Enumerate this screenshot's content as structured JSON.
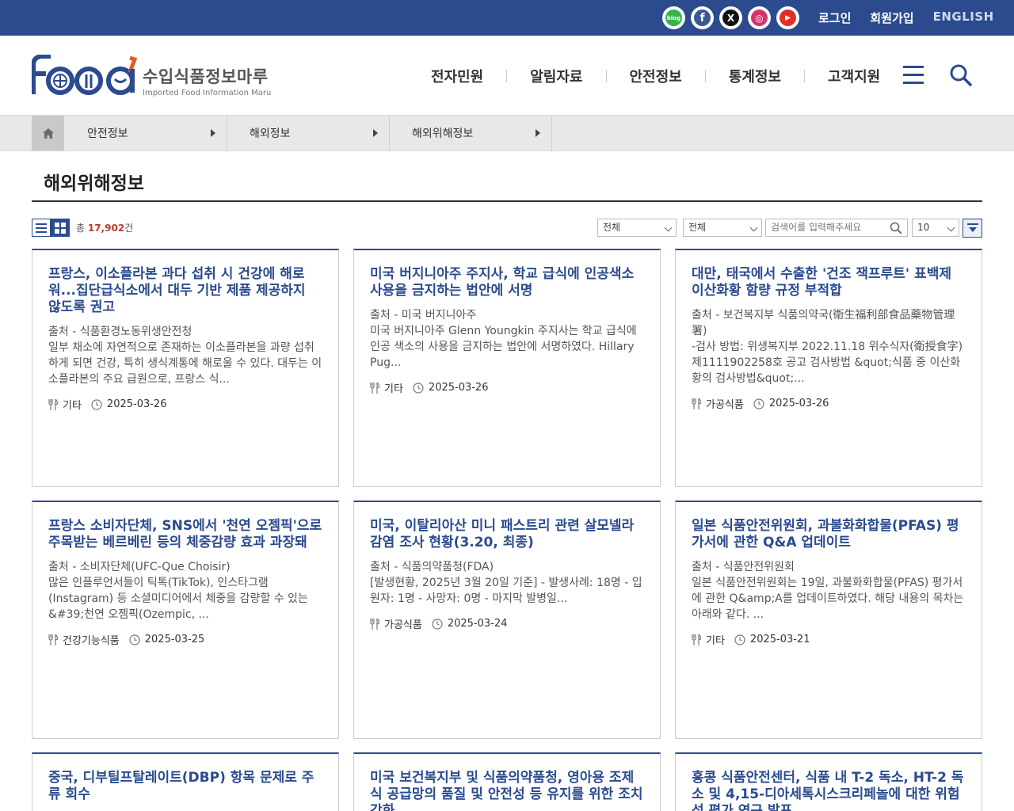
{
  "topbar": {
    "social_icons": [
      {
        "name": "blog-icon",
        "label": "blog",
        "color": "#35b34a"
      },
      {
        "name": "facebook-icon",
        "label": "f",
        "color": "#3b5998"
      },
      {
        "name": "x-icon",
        "label": "X",
        "color": "#111111"
      },
      {
        "name": "instagram-icon",
        "label": "◎",
        "color": "#d6336c"
      },
      {
        "name": "youtube-icon",
        "label": "▶",
        "color": "#e52d27"
      }
    ],
    "login": "로그인",
    "signup": "회원가입",
    "english": "ENGLISH"
  },
  "header": {
    "logo_kr": "수입식품정보마루",
    "logo_en": "Imported Food Information Maru",
    "menu": [
      "전자민원",
      "알림자료",
      "안전정보",
      "통계정보",
      "고객지원"
    ]
  },
  "breadcrumb": [
    "안전정보",
    "해외정보",
    "해외위해정보"
  ],
  "page_title": "해외위해정보",
  "toolbar": {
    "count_prefix": "총 ",
    "count_value": "17,902",
    "count_suffix": "건",
    "filter1": "전체",
    "filter2": "전체",
    "search_placeholder": "검색어를 입력해주세요",
    "page_size": "10"
  },
  "colors": {
    "brand": "#2b4b8e",
    "highlight": "#c0392b"
  },
  "cards": [
    {
      "title": "프랑스, 이소플라본 과다 섭취 시 건강에 해로워...집단급식소에서 대두 기반 제품 제공하지 않도록 권고",
      "source": "출처 - 식품환경노동위생안전청",
      "desc": "일부 채소에 자연적으로 존재하는 이소플라본을 과량 섭취하게 되면 건강, 특히 생식계통에 해로울 수 있다. 대두는 이소플라본의 주요 급원으로, 프랑스 식...",
      "category": "기타",
      "date": "2025-03-26"
    },
    {
      "title": "미국 버지니아주 주지사, 학교 급식에 인공색소 사용을 금지하는 법안에 서명",
      "source": "출처 - 미국 버지니아주",
      "desc": "미국 버지니아주 Glenn Youngkin 주지사는 학교 급식에 인공 색소의 사용을 금지하는 법안에 서명하였다. Hillary Pug...",
      "category": "기타",
      "date": "2025-03-26"
    },
    {
      "title": "대만, 태국에서 수출한 '건조 잭프루트' 표백제 이산화황 함량 규정 부적합",
      "source": "출처 - 보건복지부 식품의약국(衛生福利部食品藥物管理署)",
      "desc": "-검사 방법: 위생복지부 2022.11.18 위수식자(衛授食字) 제1111902258호 공고 검사방법 &quot;식품 중 이산화황의 검사방법&quot;...",
      "category": "가공식품",
      "date": "2025-03-26"
    },
    {
      "title": "프랑스 소비자단체, SNS에서 '천연 오젬픽'으로 주목받는 베르베린 등의 체중감량 효과 과장돼",
      "source": "출처 - 소비자단체(UFC-Que Choisir)",
      "desc": "많은 인플루언서들이 틱톡(TikTok), 인스타그램(Instagram) 등 소셜미디어에서 체중을 감량할 수 있는 &#39;천연 오젬픽(Ozempic, ...",
      "category": "건강기능식품",
      "date": "2025-03-25"
    },
    {
      "title": "미국, 이탈리아산 미니 패스트리 관련 살모넬라 감염 조사 현황(3.20, 최종)",
      "source": "출처 - 식품의약품청(FDA)",
      "desc": "[발생현황, 2025년 3월 20일 기준] - 발생사례: 18명 - 입원자: 1명 - 사망자: 0명 - 마지막 발병일...",
      "category": "가공식품",
      "date": "2025-03-24"
    },
    {
      "title": "일본 식품안전위원회, 과불화화합물(PFAS) 평가서에 관한 Q&A 업데이트",
      "source": "출처 - 식품안전위원회",
      "desc": "일본 식품안전위원회는 19일, 과불화화합물(PFAS) 평가서에 관한 Q&amp;A를 업데이트하였다. 해당 내용의 목차는 아래와 같다. ...",
      "category": "기타",
      "date": "2025-03-21"
    },
    {
      "title": "중국, 디부틸프탈레이트(DBP) 항목 문제로 주류 회수",
      "source": "",
      "desc": "",
      "category": "",
      "date": ""
    },
    {
      "title": "미국 보건복지부 및 식품의약품청, 영아용 조제식 공급망의 품질 및 안전성 등 유지를 위한 조치 강화",
      "source": "",
      "desc": "",
      "category": "",
      "date": ""
    },
    {
      "title": "홍콩 식품안전센터, 식품 내 T-2 독소, HT-2 독소 및 4,15-디아세톡시스크리페놀에 대한 위험성 평가 연구 발표",
      "source": "",
      "desc": "",
      "category": "",
      "date": ""
    }
  ]
}
